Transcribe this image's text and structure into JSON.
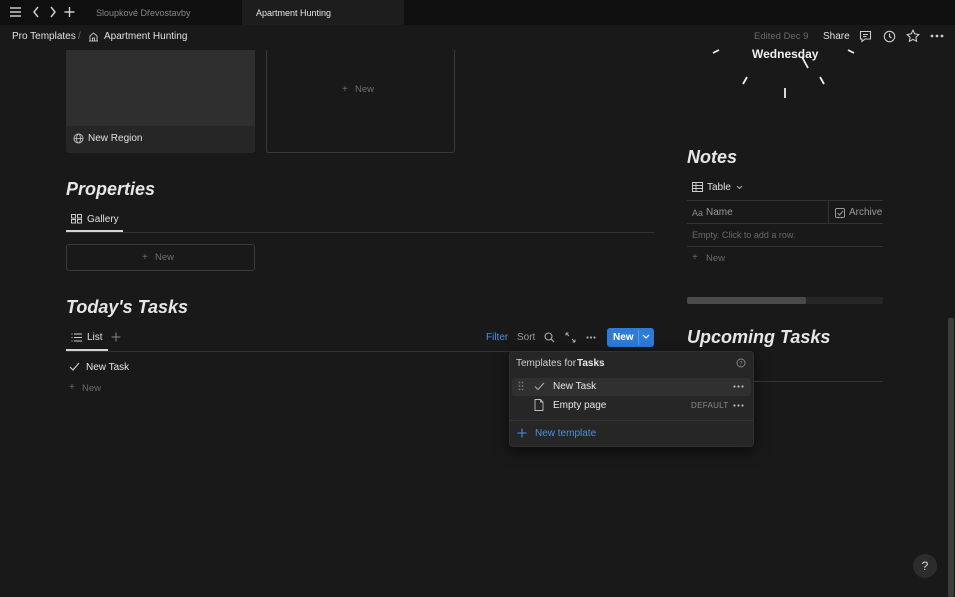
{
  "tabs": [
    {
      "label": "Sloupkové Dřevostavby"
    },
    {
      "label": "Apartment Hunting"
    }
  ],
  "header": {
    "breadcrumb_root": "Pro Templates",
    "breadcrumb_separator": "/",
    "breadcrumb_page": "Apartment Hunting",
    "edited": "Edited Dec 9",
    "share_label": "Share"
  },
  "regions": {
    "new_region_label": "New Region",
    "new_card_label": "New"
  },
  "properties": {
    "title": "Properties",
    "view_label": "Gallery",
    "new_label": "New"
  },
  "tasks": {
    "title": "Today's Tasks",
    "view_label": "List",
    "filter_label": "Filter",
    "sort_label": "Sort",
    "new_label": "New",
    "items": [
      {
        "label": "New Task"
      }
    ],
    "add_label": "New"
  },
  "templates_popover": {
    "title_prefix": "Templates for",
    "title_db": "Tasks",
    "items": [
      {
        "label": "New Task",
        "badge": ""
      },
      {
        "label": "Empty page",
        "badge": "DEFAULT"
      }
    ],
    "new_template_label": "New template"
  },
  "clock": {
    "day": "Wednesday"
  },
  "notes": {
    "title": "Notes",
    "view_label": "Table",
    "columns": [
      "Name",
      "Archive"
    ],
    "name_prefix": "Aa",
    "empty_text": "Empty. Click to add a row.",
    "new_label": "New"
  },
  "upcoming": {
    "title": "Upcoming Tasks"
  },
  "help_label": "?",
  "colors": {
    "accent_blue": "#2e7bd6",
    "background": "#191919"
  }
}
